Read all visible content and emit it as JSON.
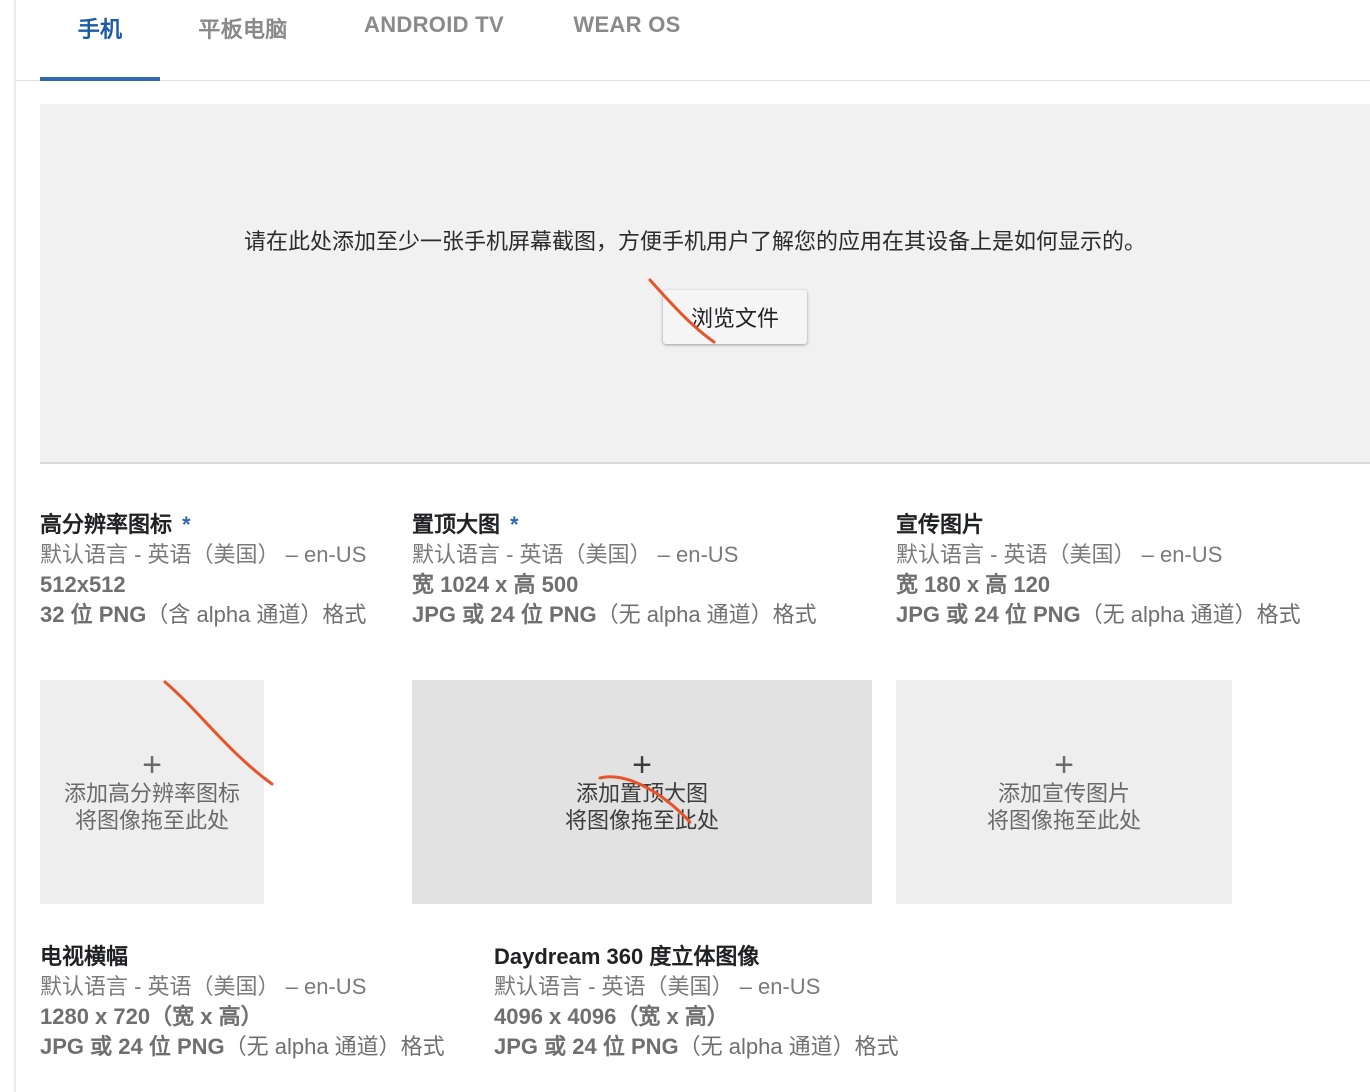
{
  "tabs": [
    {
      "label": "手机",
      "active": true
    },
    {
      "label": "平板电脑",
      "active": false
    },
    {
      "label": "ANDROID TV",
      "active": false
    },
    {
      "label": "WEAR OS",
      "active": false
    }
  ],
  "screenshots": {
    "message": "请在此处添加至少一张手机屏幕截图，方便手机用户了解您的应用在其设备上是如何显示的。",
    "browse_label": "浏览文件"
  },
  "assets": {
    "hires_icon": {
      "title": "高分辨率图标",
      "required_mark": "*",
      "language": "默认语言 - 英语（美国） – en-US",
      "dimensions": "512x512",
      "format_bold": "32 位 PNG",
      "format_rest": "（含 alpha 通道）格式",
      "drop_plus": "+",
      "drop_line1": "添加高分辨率图标",
      "drop_line2": "将图像拖至此处"
    },
    "feature_graphic": {
      "title": "置顶大图",
      "required_mark": "*",
      "language": "默认语言 - 英语（美国） – en-US",
      "dimensions": "宽 1024 x 高 500",
      "format_bold": "JPG 或 24 位 PNG",
      "format_rest": "（无 alpha 通道）格式",
      "drop_plus": "+",
      "drop_line1": "添加置顶大图",
      "drop_line2": "将图像拖至此处"
    },
    "promo_graphic": {
      "title": "宣传图片",
      "language": "默认语言 - 英语（美国） – en-US",
      "dimensions": "宽 180 x 高 120",
      "format_bold": "JPG 或 24 位 PNG",
      "format_rest": "（无 alpha 通道）格式",
      "drop_plus": "+",
      "drop_line1": "添加宣传图片",
      "drop_line2": "将图像拖至此处"
    },
    "tv_banner": {
      "title": "电视横幅",
      "language": "默认语言 - 英语（美国） – en-US",
      "dimensions": "1280 x 720（宽 x 高）",
      "format_bold": "JPG 或 24 位 PNG",
      "format_rest": "（无 alpha 通道）格式"
    },
    "daydream": {
      "title": "Daydream 360 度立体图像",
      "language": "默认语言 - 英语（美国） – en-US",
      "dimensions": "4096 x 4096（宽 x 高）",
      "format_bold": "JPG 或 24 位 PNG",
      "format_rest": "（无 alpha 通道）格式"
    }
  },
  "colors": {
    "accent": "#2f67b1",
    "annotation": "#e8542a"
  }
}
